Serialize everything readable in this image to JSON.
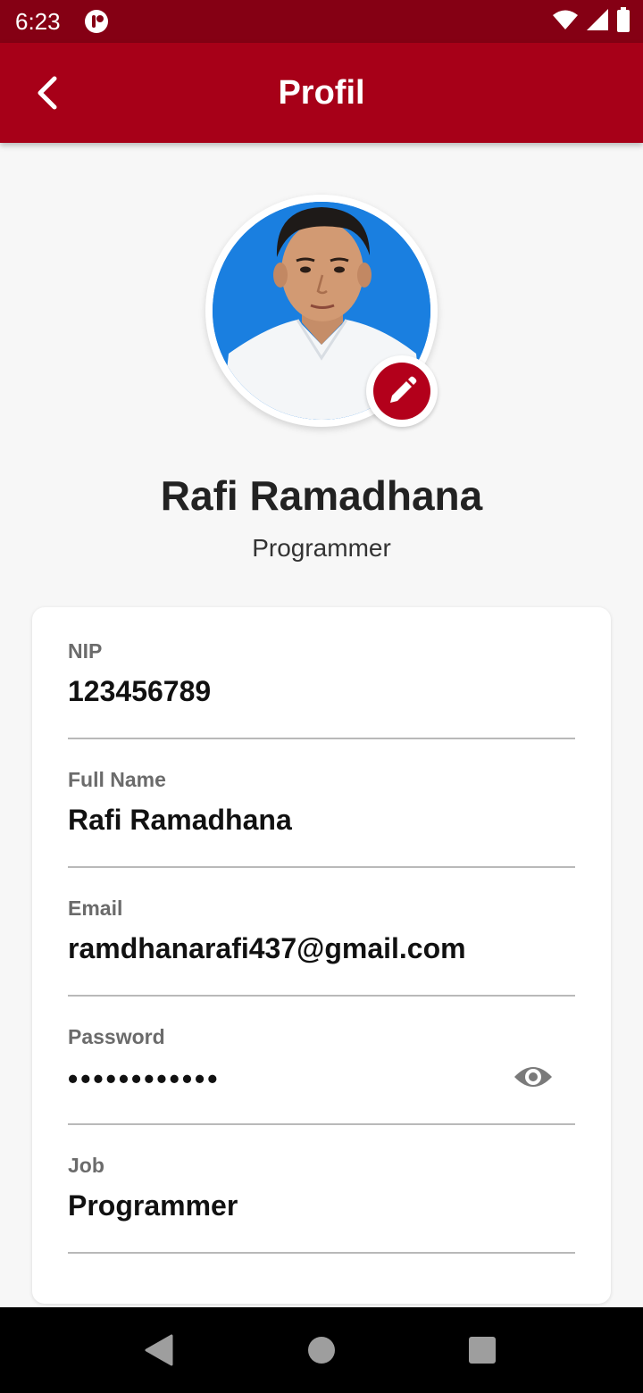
{
  "status_bar": {
    "time": "6:23",
    "icons": [
      "notification-app-icon",
      "wifi-icon",
      "signal-icon",
      "battery-icon"
    ]
  },
  "app_bar": {
    "title": "Profil",
    "back_icon": "chevron-left-icon",
    "background_color": "#a70018"
  },
  "profile": {
    "name": "Rafi Ramadhana",
    "job": "Programmer",
    "edit_icon": "pencil-icon"
  },
  "fields": [
    {
      "label": "NIP",
      "value": "123456789"
    },
    {
      "label": "Full Name",
      "value": "Rafi Ramadhana"
    },
    {
      "label": "Email",
      "value": "ramdhanarafi437@gmail.com"
    },
    {
      "label": "Password",
      "value": "••••••••••••",
      "icon": "eye-icon"
    },
    {
      "label": "Job",
      "value": "Programmer"
    }
  ],
  "nav_bar": {
    "icons": [
      "nav-back-icon",
      "nav-home-icon",
      "nav-recents-icon"
    ]
  },
  "colors": {
    "accent": "#a70018",
    "status_bar": "#850014"
  }
}
